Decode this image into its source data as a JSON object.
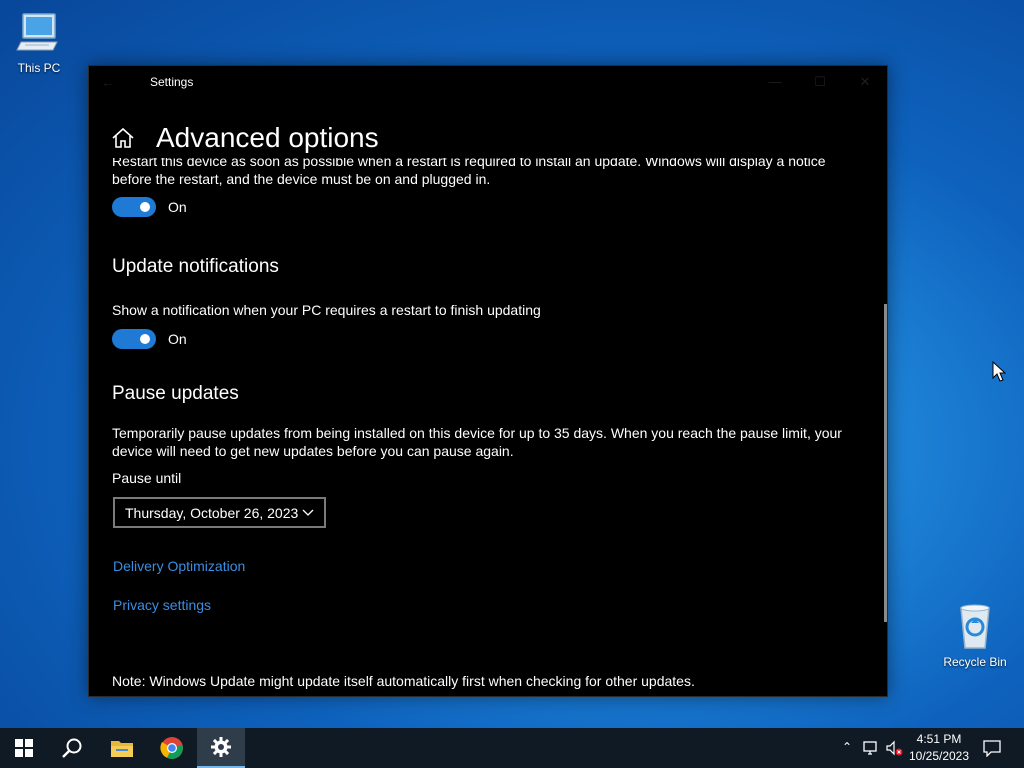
{
  "desktop": {
    "icons": [
      {
        "label": "This PC",
        "icon": "this-pc-icon"
      },
      {
        "label": "Recycle Bin",
        "icon": "recycle-bin-icon"
      }
    ]
  },
  "window": {
    "title": "Settings",
    "page_title": "Advanced options",
    "restart_notice_cut": "Restart this device as soon as possible when a restart is required to install an update. Windows will display a notice",
    "restart_notice_rest": "before the restart, and the device must be on and plugged in.",
    "restart_toggle": {
      "state": "On",
      "on": true
    },
    "update_notifications": {
      "heading": "Update notifications",
      "description": "Show a notification when your PC requires a restart to finish updating",
      "toggle": {
        "state": "On",
        "on": true
      }
    },
    "pause_updates": {
      "heading": "Pause updates",
      "description": "Temporarily pause updates from being installed on this device for up to 35 days. When you reach the pause limit, your device will need to get new updates before you can pause again.",
      "pause_until_label": "Pause until",
      "pause_until_value": "Thursday, October 26, 2023"
    },
    "links": {
      "delivery_optimization": "Delivery Optimization",
      "privacy_settings": "Privacy settings"
    },
    "note": "Note: Windows Update might update itself automatically first when checking for other updates."
  },
  "taskbar": {
    "apps": [
      "start-icon",
      "search-icon",
      "file-explorer-icon",
      "chrome-icon",
      "settings-icon"
    ],
    "active_app": "settings-icon",
    "clock": {
      "time": "4:51 PM",
      "date": "10/25/2023"
    }
  },
  "colors": {
    "accent": "#1f7ad6",
    "link": "#3b8de0",
    "window_bg": "#000000",
    "taskbar_bg": "#101a24"
  }
}
